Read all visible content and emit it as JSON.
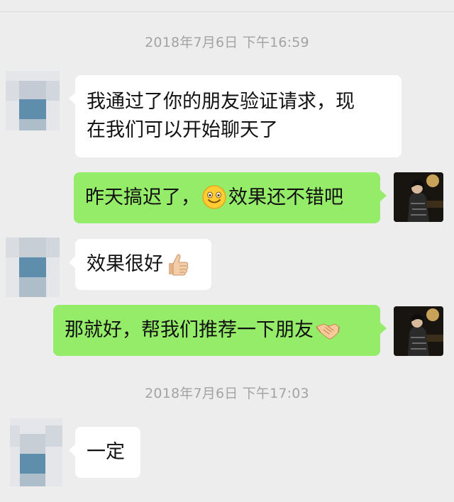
{
  "chat": {
    "timestamps": [
      "2018年7月6日 下午16:59",
      "2018年7月6日 下午17:03"
    ],
    "messages": [
      {
        "from": "contact",
        "line1": "我通过了你的朋友验证请求，现",
        "line2": "在我们可以开始聊天了"
      },
      {
        "from": "me",
        "before": "昨天搞迟了，",
        "emoji": "smile-emoji",
        "after": "效果还不错吧"
      },
      {
        "from": "contact",
        "text": "效果很好",
        "emoji": "thumbs-up-emoji"
      },
      {
        "from": "me",
        "text": "那就好，帮我们推荐一下朋友",
        "emoji": "handshake-emoji"
      },
      {
        "from": "contact",
        "text": "一定"
      }
    ]
  },
  "colors": {
    "background": "#ededed",
    "incoming_bubble": "#ffffff",
    "outgoing_bubble": "#95ec69",
    "timestamp": "#a3a3a3"
  }
}
